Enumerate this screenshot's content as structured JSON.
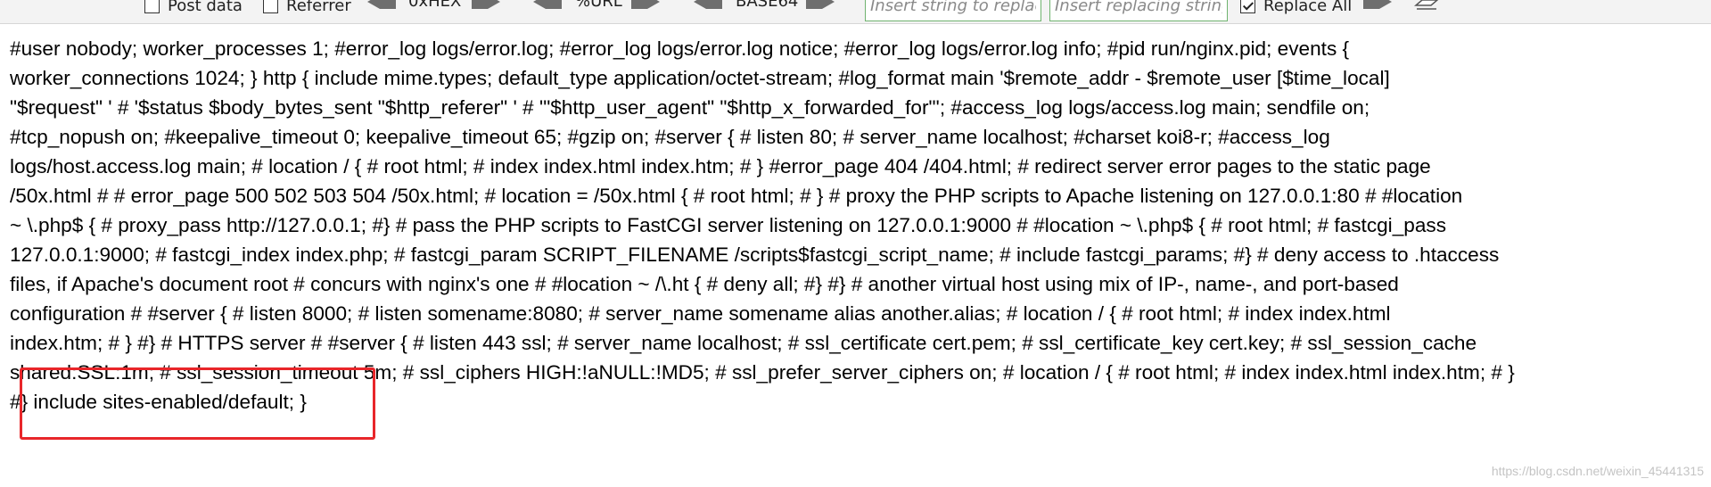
{
  "toolbar": {
    "post_data": {
      "label": "Post data",
      "checked": false
    },
    "referrer": {
      "label": "Referrer",
      "checked": false
    },
    "encoders": [
      {
        "label": "0xHEX"
      },
      {
        "label": "%URL"
      },
      {
        "label": "BASE64"
      }
    ],
    "search_placeholder": "Insert string to replace",
    "replace_placeholder": "Insert replacing string",
    "replace_all": {
      "label": "Replace All",
      "checked": true
    }
  },
  "content": {
    "lines": [
      "#user nobody; worker_processes 1; #error_log logs/error.log; #error_log logs/error.log notice; #error_log logs/error.log info; #pid run/nginx.pid; events {",
      "worker_connections 1024; } http { include mime.types; default_type application/octet-stream; #log_format main '$remote_addr - $remote_user [$time_local]",
      "\"$request\" ' # '$status $body_bytes_sent \"$http_referer\" ' # '\"$http_user_agent\" \"$http_x_forwarded_for\"'; #access_log logs/access.log main; sendfile on;",
      "#tcp_nopush on; #keepalive_timeout 0; keepalive_timeout 65; #gzip on; #server { # listen 80; # server_name localhost; #charset koi8-r; #access_log",
      "logs/host.access.log main; # location / { # root html; # index index.html index.htm; # } #error_page 404 /404.html; # redirect server error pages to the static page",
      "/50x.html # # error_page 500 502 503 504 /50x.html; # location = /50x.html { # root html; # } # proxy the PHP scripts to Apache listening on 127.0.0.1:80 # #location",
      "~ \\.php$ { # proxy_pass http://127.0.0.1; #} # pass the PHP scripts to FastCGI server listening on 127.0.0.1:9000 # #location ~ \\.php$ { # root html; # fastcgi_pass",
      "127.0.0.1:9000; # fastcgi_index index.php; # fastcgi_param SCRIPT_FILENAME /scripts$fastcgi_script_name; # include fastcgi_params; #} # deny access to .htaccess",
      "files, if Apache's document root # concurs with nginx's one # #location ~ /\\.ht { # deny all; #} #} # another virtual host using mix of IP-, name-, and port-based",
      "configuration # #server { # listen 8000; # listen somename:8080; # server_name somename alias another.alias; # location / { # root html; # index index.html",
      "index.htm; # } #} # HTTPS server # #server { # listen 443 ssl; # server_name localhost; # ssl_certificate cert.pem; # ssl_certificate_key cert.key; # ssl_session_cache",
      "shared:SSL:1m; # ssl_session_timeout 5m; # ssl_ciphers HIGH:!aNULL:!MD5; # ssl_prefer_server_ciphers on; # location / { # root html; # index index.html index.htm; # }",
      "#} include sites-enabled/default; }"
    ]
  },
  "annotation": {
    "color": "#e8262a"
  },
  "watermark": "https://blog.csdn.net/weixin_45441315"
}
